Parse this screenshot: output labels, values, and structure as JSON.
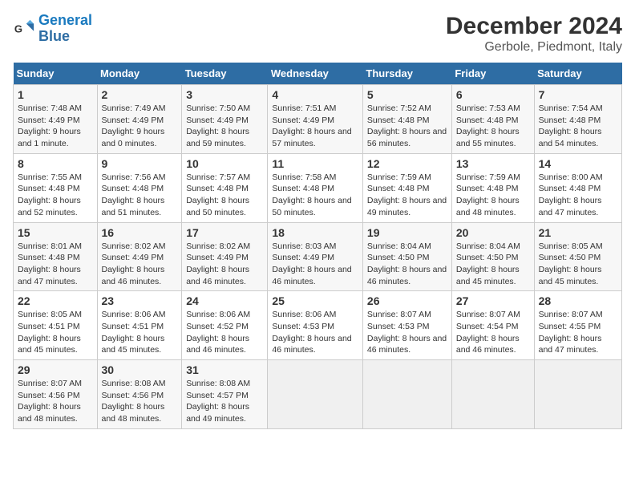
{
  "logo": {
    "general": "General",
    "blue": "Blue"
  },
  "title": "December 2024",
  "subtitle": "Gerbole, Piedmont, Italy",
  "days_header": [
    "Sunday",
    "Monday",
    "Tuesday",
    "Wednesday",
    "Thursday",
    "Friday",
    "Saturday"
  ],
  "weeks": [
    [
      {
        "day": "1",
        "sunrise": "Sunrise: 7:48 AM",
        "sunset": "Sunset: 4:49 PM",
        "daylight": "Daylight: 9 hours and 1 minute."
      },
      {
        "day": "2",
        "sunrise": "Sunrise: 7:49 AM",
        "sunset": "Sunset: 4:49 PM",
        "daylight": "Daylight: 9 hours and 0 minutes."
      },
      {
        "day": "3",
        "sunrise": "Sunrise: 7:50 AM",
        "sunset": "Sunset: 4:49 PM",
        "daylight": "Daylight: 8 hours and 59 minutes."
      },
      {
        "day": "4",
        "sunrise": "Sunrise: 7:51 AM",
        "sunset": "Sunset: 4:49 PM",
        "daylight": "Daylight: 8 hours and 57 minutes."
      },
      {
        "day": "5",
        "sunrise": "Sunrise: 7:52 AM",
        "sunset": "Sunset: 4:48 PM",
        "daylight": "Daylight: 8 hours and 56 minutes."
      },
      {
        "day": "6",
        "sunrise": "Sunrise: 7:53 AM",
        "sunset": "Sunset: 4:48 PM",
        "daylight": "Daylight: 8 hours and 55 minutes."
      },
      {
        "day": "7",
        "sunrise": "Sunrise: 7:54 AM",
        "sunset": "Sunset: 4:48 PM",
        "daylight": "Daylight: 8 hours and 54 minutes."
      }
    ],
    [
      {
        "day": "8",
        "sunrise": "Sunrise: 7:55 AM",
        "sunset": "Sunset: 4:48 PM",
        "daylight": "Daylight: 8 hours and 52 minutes."
      },
      {
        "day": "9",
        "sunrise": "Sunrise: 7:56 AM",
        "sunset": "Sunset: 4:48 PM",
        "daylight": "Daylight: 8 hours and 51 minutes."
      },
      {
        "day": "10",
        "sunrise": "Sunrise: 7:57 AM",
        "sunset": "Sunset: 4:48 PM",
        "daylight": "Daylight: 8 hours and 50 minutes."
      },
      {
        "day": "11",
        "sunrise": "Sunrise: 7:58 AM",
        "sunset": "Sunset: 4:48 PM",
        "daylight": "Daylight: 8 hours and 50 minutes."
      },
      {
        "day": "12",
        "sunrise": "Sunrise: 7:59 AM",
        "sunset": "Sunset: 4:48 PM",
        "daylight": "Daylight: 8 hours and 49 minutes."
      },
      {
        "day": "13",
        "sunrise": "Sunrise: 7:59 AM",
        "sunset": "Sunset: 4:48 PM",
        "daylight": "Daylight: 8 hours and 48 minutes."
      },
      {
        "day": "14",
        "sunrise": "Sunrise: 8:00 AM",
        "sunset": "Sunset: 4:48 PM",
        "daylight": "Daylight: 8 hours and 47 minutes."
      }
    ],
    [
      {
        "day": "15",
        "sunrise": "Sunrise: 8:01 AM",
        "sunset": "Sunset: 4:48 PM",
        "daylight": "Daylight: 8 hours and 47 minutes."
      },
      {
        "day": "16",
        "sunrise": "Sunrise: 8:02 AM",
        "sunset": "Sunset: 4:49 PM",
        "daylight": "Daylight: 8 hours and 46 minutes."
      },
      {
        "day": "17",
        "sunrise": "Sunrise: 8:02 AM",
        "sunset": "Sunset: 4:49 PM",
        "daylight": "Daylight: 8 hours and 46 minutes."
      },
      {
        "day": "18",
        "sunrise": "Sunrise: 8:03 AM",
        "sunset": "Sunset: 4:49 PM",
        "daylight": "Daylight: 8 hours and 46 minutes."
      },
      {
        "day": "19",
        "sunrise": "Sunrise: 8:04 AM",
        "sunset": "Sunset: 4:50 PM",
        "daylight": "Daylight: 8 hours and 46 minutes."
      },
      {
        "day": "20",
        "sunrise": "Sunrise: 8:04 AM",
        "sunset": "Sunset: 4:50 PM",
        "daylight": "Daylight: 8 hours and 45 minutes."
      },
      {
        "day": "21",
        "sunrise": "Sunrise: 8:05 AM",
        "sunset": "Sunset: 4:50 PM",
        "daylight": "Daylight: 8 hours and 45 minutes."
      }
    ],
    [
      {
        "day": "22",
        "sunrise": "Sunrise: 8:05 AM",
        "sunset": "Sunset: 4:51 PM",
        "daylight": "Daylight: 8 hours and 45 minutes."
      },
      {
        "day": "23",
        "sunrise": "Sunrise: 8:06 AM",
        "sunset": "Sunset: 4:51 PM",
        "daylight": "Daylight: 8 hours and 45 minutes."
      },
      {
        "day": "24",
        "sunrise": "Sunrise: 8:06 AM",
        "sunset": "Sunset: 4:52 PM",
        "daylight": "Daylight: 8 hours and 46 minutes."
      },
      {
        "day": "25",
        "sunrise": "Sunrise: 8:06 AM",
        "sunset": "Sunset: 4:53 PM",
        "daylight": "Daylight: 8 hours and 46 minutes."
      },
      {
        "day": "26",
        "sunrise": "Sunrise: 8:07 AM",
        "sunset": "Sunset: 4:53 PM",
        "daylight": "Daylight: 8 hours and 46 minutes."
      },
      {
        "day": "27",
        "sunrise": "Sunrise: 8:07 AM",
        "sunset": "Sunset: 4:54 PM",
        "daylight": "Daylight: 8 hours and 46 minutes."
      },
      {
        "day": "28",
        "sunrise": "Sunrise: 8:07 AM",
        "sunset": "Sunset: 4:55 PM",
        "daylight": "Daylight: 8 hours and 47 minutes."
      }
    ],
    [
      {
        "day": "29",
        "sunrise": "Sunrise: 8:07 AM",
        "sunset": "Sunset: 4:56 PM",
        "daylight": "Daylight: 8 hours and 48 minutes."
      },
      {
        "day": "30",
        "sunrise": "Sunrise: 8:08 AM",
        "sunset": "Sunset: 4:56 PM",
        "daylight": "Daylight: 8 hours and 48 minutes."
      },
      {
        "day": "31",
        "sunrise": "Sunrise: 8:08 AM",
        "sunset": "Sunset: 4:57 PM",
        "daylight": "Daylight: 8 hours and 49 minutes."
      },
      null,
      null,
      null,
      null
    ]
  ]
}
